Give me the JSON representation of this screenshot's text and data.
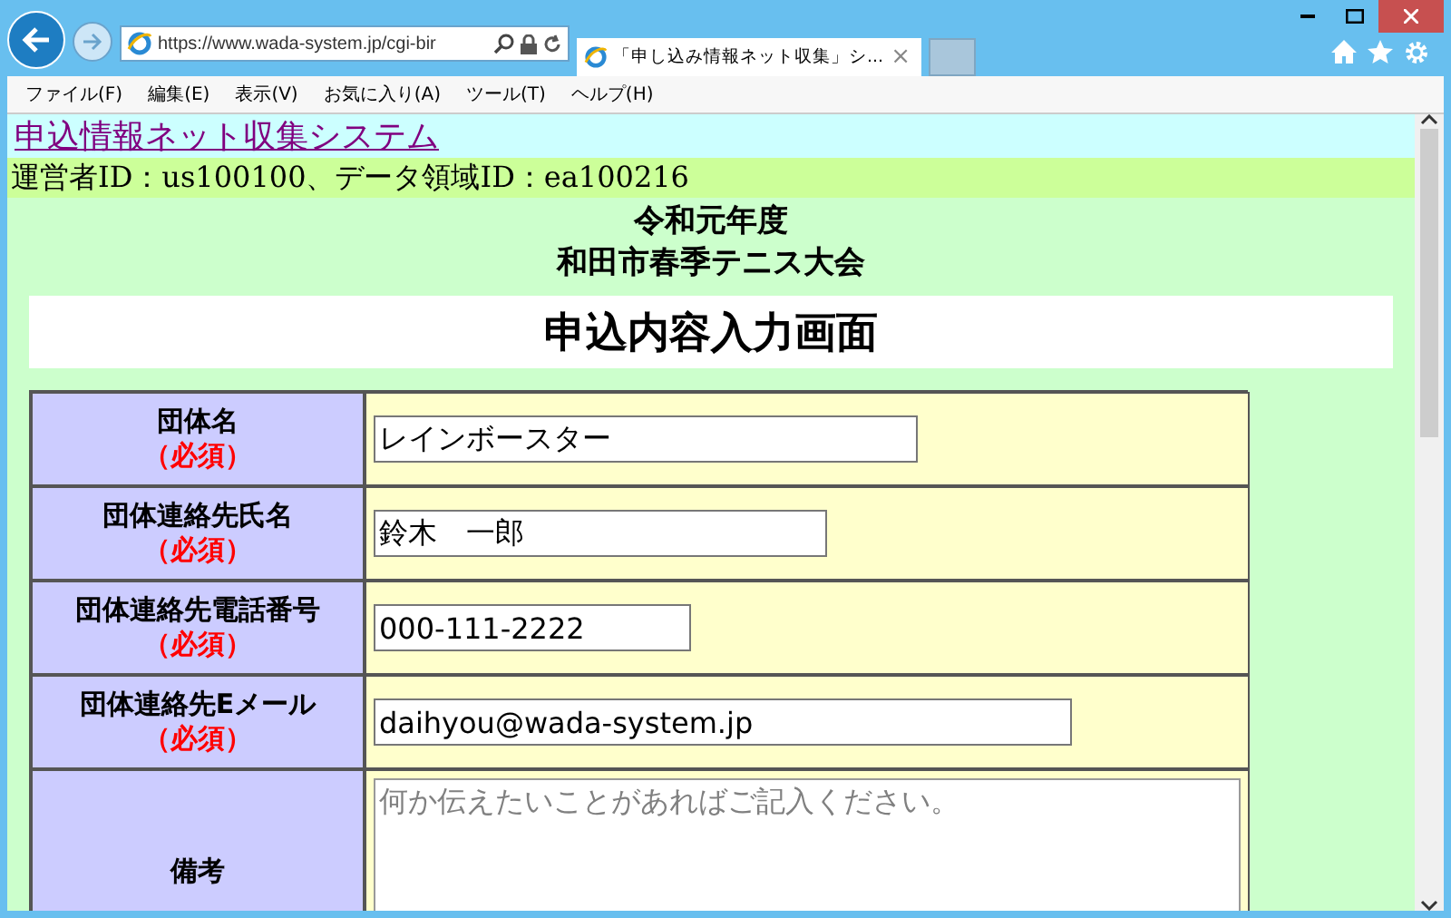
{
  "browser": {
    "address": "https://www.wada-system.jp/cgi-bir",
    "tab_title": "「申し込み情報ネット収集」シ...",
    "tab_close": "×",
    "menu": [
      "ファイル(F)",
      "編集(E)",
      "表示(V)",
      "お気に入り(A)",
      "ツール(T)",
      "ヘルプ(H)"
    ]
  },
  "page": {
    "site_link": "申込情報ネット収集システム",
    "operator_info": "運営者ID：us100100、データ領域ID：ea100216",
    "event_year": "令和元年度",
    "event_name": "和田市春季テニス大会",
    "heading": "申込内容入力画面",
    "form": [
      {
        "kind": "input",
        "label": "団体名",
        "required": "（必須）",
        "value": "レインボースター"
      },
      {
        "kind": "input",
        "label": "団体連絡先氏名",
        "required": "（必須）",
        "value": "鈴木　一郎"
      },
      {
        "kind": "input",
        "label": "団体連絡先電話番号",
        "required": "（必須）",
        "value": "000-111-2222"
      },
      {
        "kind": "input",
        "label": "団体連絡先Eメール",
        "required": "（必須）",
        "value": "daihyou@wada-system.jp"
      },
      {
        "kind": "textarea",
        "label": "備考",
        "placeholder": "何か伝えたいことがあればご記入ください。"
      }
    ]
  }
}
